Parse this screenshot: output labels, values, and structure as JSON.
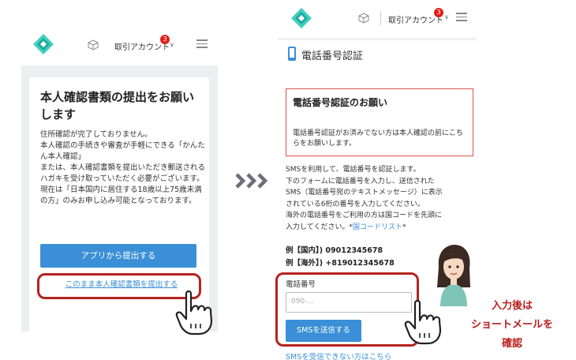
{
  "left_phone": {
    "header": {
      "account_label": "取引アカウント",
      "badge_count": "3"
    },
    "card": {
      "title": "本人確認書類の提出をお願いします",
      "body_lines": [
        "住所確認が完了しておりません。",
        "本人確認の手続きや審査が手軽にできる「かんたん本人確認」",
        "または、本人確認書類を提出いただき郵送されるハガキを受け取っていただく必要がございます。",
        "現在は「日本国内に居住する18歳以上75歳未満の方」のみお申し込み可能となっております。"
      ],
      "app_submit_button": "アプリから提出する",
      "direct_submit_link": "このまま本人確認書類を提出する"
    }
  },
  "right_phone": {
    "header": {
      "account_label": "取引アカウント",
      "badge_count": "3"
    },
    "page_title": "電話番号認証",
    "notice": {
      "title": "電話番号認証のお願い",
      "text": "電話番号認証がお済みでない方は本人確認の前にこちらをお願いします。"
    },
    "body_lines": [
      "SMSを利用して、電話番号を認証します。",
      "下のフォームに電話番号を入力し、送信された",
      "SMS（電話番号宛のテキストメッセージ）に表示",
      "されている6桁の番号を入力してください。",
      "海外の電話番号をご利用の方は国コードを先頭に"
    ],
    "body_last_prefix": "入力してください。*",
    "country_code_link": "国コードリスト",
    "body_last_suffix": "*",
    "example_domestic": "例【国内】) 09012345678",
    "example_overseas": "例【海外】) +819012345678",
    "phone_label": "電話番号",
    "phone_placeholder": "090-...",
    "send_sms_button": "SMSを送信する",
    "no_sms_link": "SMSを受信できない方はこちら"
  },
  "annotation": {
    "lines": [
      "入力後は",
      "ショートメールを",
      "確認"
    ]
  },
  "colors": {
    "brand_teal": "#2ec4b6",
    "button_blue": "#3a8fd6",
    "highlight_red": "#b5231f",
    "badge_red": "#e0201b"
  },
  "icons": [
    "logo-icon",
    "box-icon",
    "chevron-down-icon",
    "menu-icon",
    "smartphone-icon",
    "pointing-hand-icon",
    "triple-arrow-icon"
  ]
}
